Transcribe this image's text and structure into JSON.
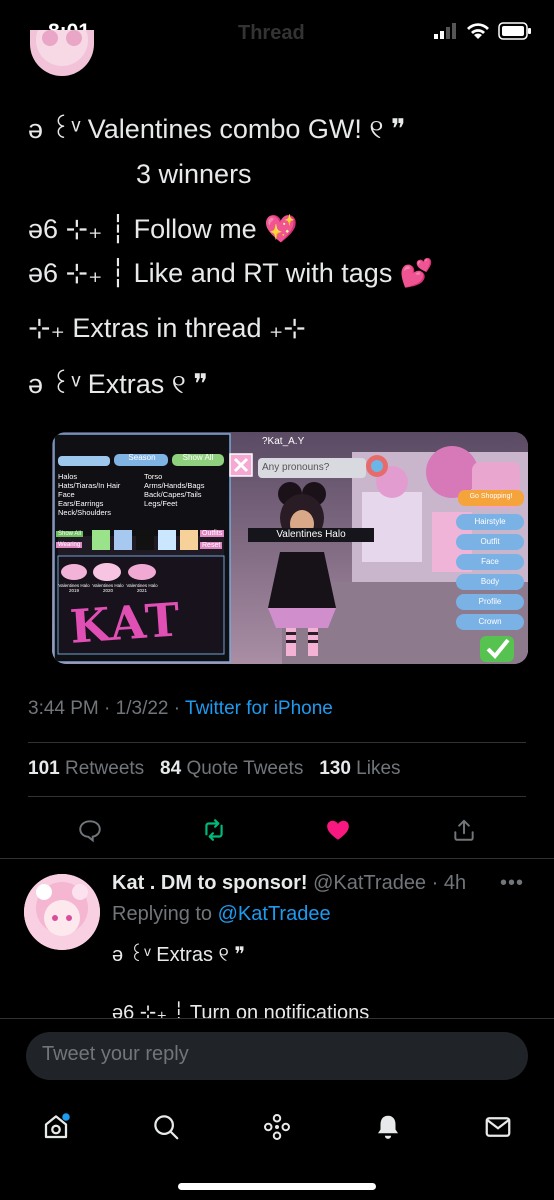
{
  "status_bar": {
    "time": "8:01",
    "header_title": "Thread"
  },
  "tweet": {
    "lines": [
      "ə ꒰ᵛ Valentines combo GW! ୧ ❞",
      "3 winners",
      "ə6 ⊹₊ ┆ Follow me 💖",
      "ə6 ⊹₊ ┆ Like and RT with tags 💕",
      "⊹₊ Extras in thread ₊⊹",
      "ə ꒰ᵛ Extras ୧ ❞"
    ],
    "time": "3:44 PM",
    "date": "1/3/22",
    "source": "Twitter for iPhone",
    "retweets_count": "101",
    "retweets_label": "Retweets",
    "quotes_count": "84",
    "quotes_label": "Quote Tweets",
    "likes_count": "130",
    "likes_label": "Likes"
  },
  "media": {
    "menu_tabs": [
      "Season",
      "Show All"
    ],
    "categories_left": [
      "Halos",
      "Hats/Tiaras/In Hair",
      "Face",
      "Ears/Earrings",
      "Neck/Shoulders"
    ],
    "categories_right": [
      "Torso",
      "Arms/Hands/Bags",
      "Back/Capes/Tails",
      "Legs/Feet"
    ],
    "small_buttons": [
      "Show All",
      "Wearing"
    ],
    "outfits_label": "Outfits",
    "reset_label": "Reset",
    "items": [
      "Valentines Halo 2019",
      "Valentines Halo 2020",
      "Valentines Halo 2021"
    ],
    "signature": "KAT",
    "player_tag": "?Kat_A.Y",
    "chat_bubble": "Any pronouns?",
    "selected_item": "Valentines Halo",
    "shop_button": "Go Shopping!",
    "side_buttons": [
      "Hairstyle",
      "Outfit",
      "Face",
      "Body",
      "Profile",
      "Crown"
    ]
  },
  "reply": {
    "name": "Kat . DM to sponsor!",
    "handle": "@KatTradee",
    "age": "4h",
    "replying_label": "Replying to",
    "replying_handle": "@KatTradee",
    "line1": "ə ꒰ᵛ Extras ୧ ❞",
    "line2": "ə6 ⊹₊ ┆ Turn on notifications"
  },
  "composer": {
    "placeholder": "Tweet your reply"
  },
  "colors": {
    "accent": "#1d9bf0",
    "like": "#f91880",
    "retweet": "#00ba7c",
    "muted": "#71767b"
  },
  "icons": [
    "reply-icon",
    "retweet-icon",
    "like-icon",
    "share-icon",
    "home-icon",
    "search-icon",
    "spaces-icon",
    "notifications-icon",
    "messages-icon"
  ]
}
